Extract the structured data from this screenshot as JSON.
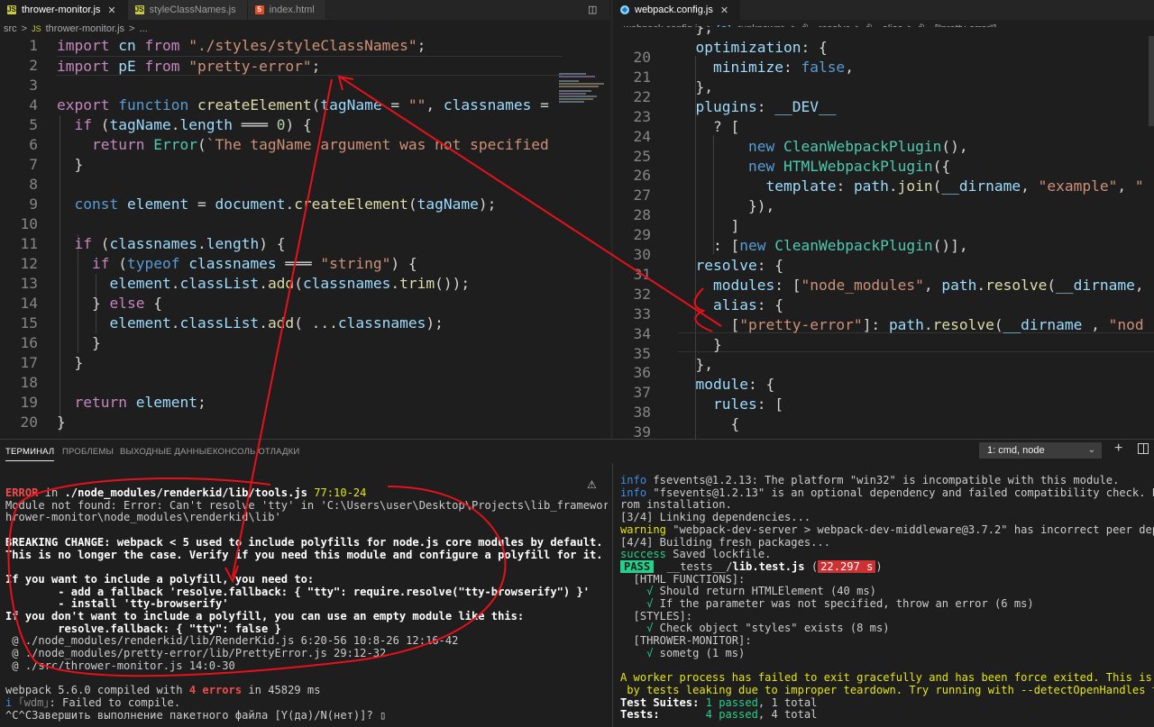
{
  "left_tabs": [
    {
      "label": "thrower-monitor.js",
      "icon": "js-icon",
      "active": true,
      "close": "✕"
    },
    {
      "label": "styleClassNames.js",
      "icon": "js-icon",
      "active": false
    },
    {
      "label": "index.html",
      "icon": "html-icon",
      "active": false
    }
  ],
  "right_tabs": [
    {
      "label": "webpack.config.js",
      "icon": "webpack-icon",
      "active": true,
      "close": "✕"
    }
  ],
  "left_breadcrumb": [
    "src",
    ">",
    "thrower-monitor.js",
    ">",
    "..."
  ],
  "right_breadcrumb": [
    "webpack.config.js",
    ">",
    "<unknown>",
    ">",
    "resolve",
    ">",
    "alias",
    ">",
    "[\"pretty-error\"]"
  ],
  "left_editor": {
    "line_numbers": [
      "1",
      "2",
      "3",
      "4",
      "5",
      "6",
      "7",
      "8",
      "9",
      "10",
      "11",
      "12",
      "13",
      "14",
      "15",
      "16",
      "17",
      "18",
      "19",
      "20"
    ]
  },
  "right_editor": {
    "line_numbers": [
      "20",
      "21",
      "22",
      "23",
      "24",
      "25",
      "26",
      "27",
      "28",
      "29",
      "30",
      "31",
      "32",
      "33",
      "34",
      "35",
      "36",
      "37",
      "38",
      "39"
    ]
  },
  "panel": {
    "tabs": [
      "ТЕРМИНАЛ",
      "ПРОБЛЕМЫ",
      "ВЫХОДНЫЕ ДАННЫЕ",
      "КОНСОЛЬ ОТЛАДКИ"
    ],
    "terminal_select": "1: cmd, node",
    "add_label": "+",
    "warning_icon": "warning-icon",
    "split_icon": "split-terminal-icon"
  },
  "colors": {
    "annotation": "#e8101a",
    "accent": "#007acc",
    "pass": "#23d18b",
    "error": "#f14c4c"
  }
}
